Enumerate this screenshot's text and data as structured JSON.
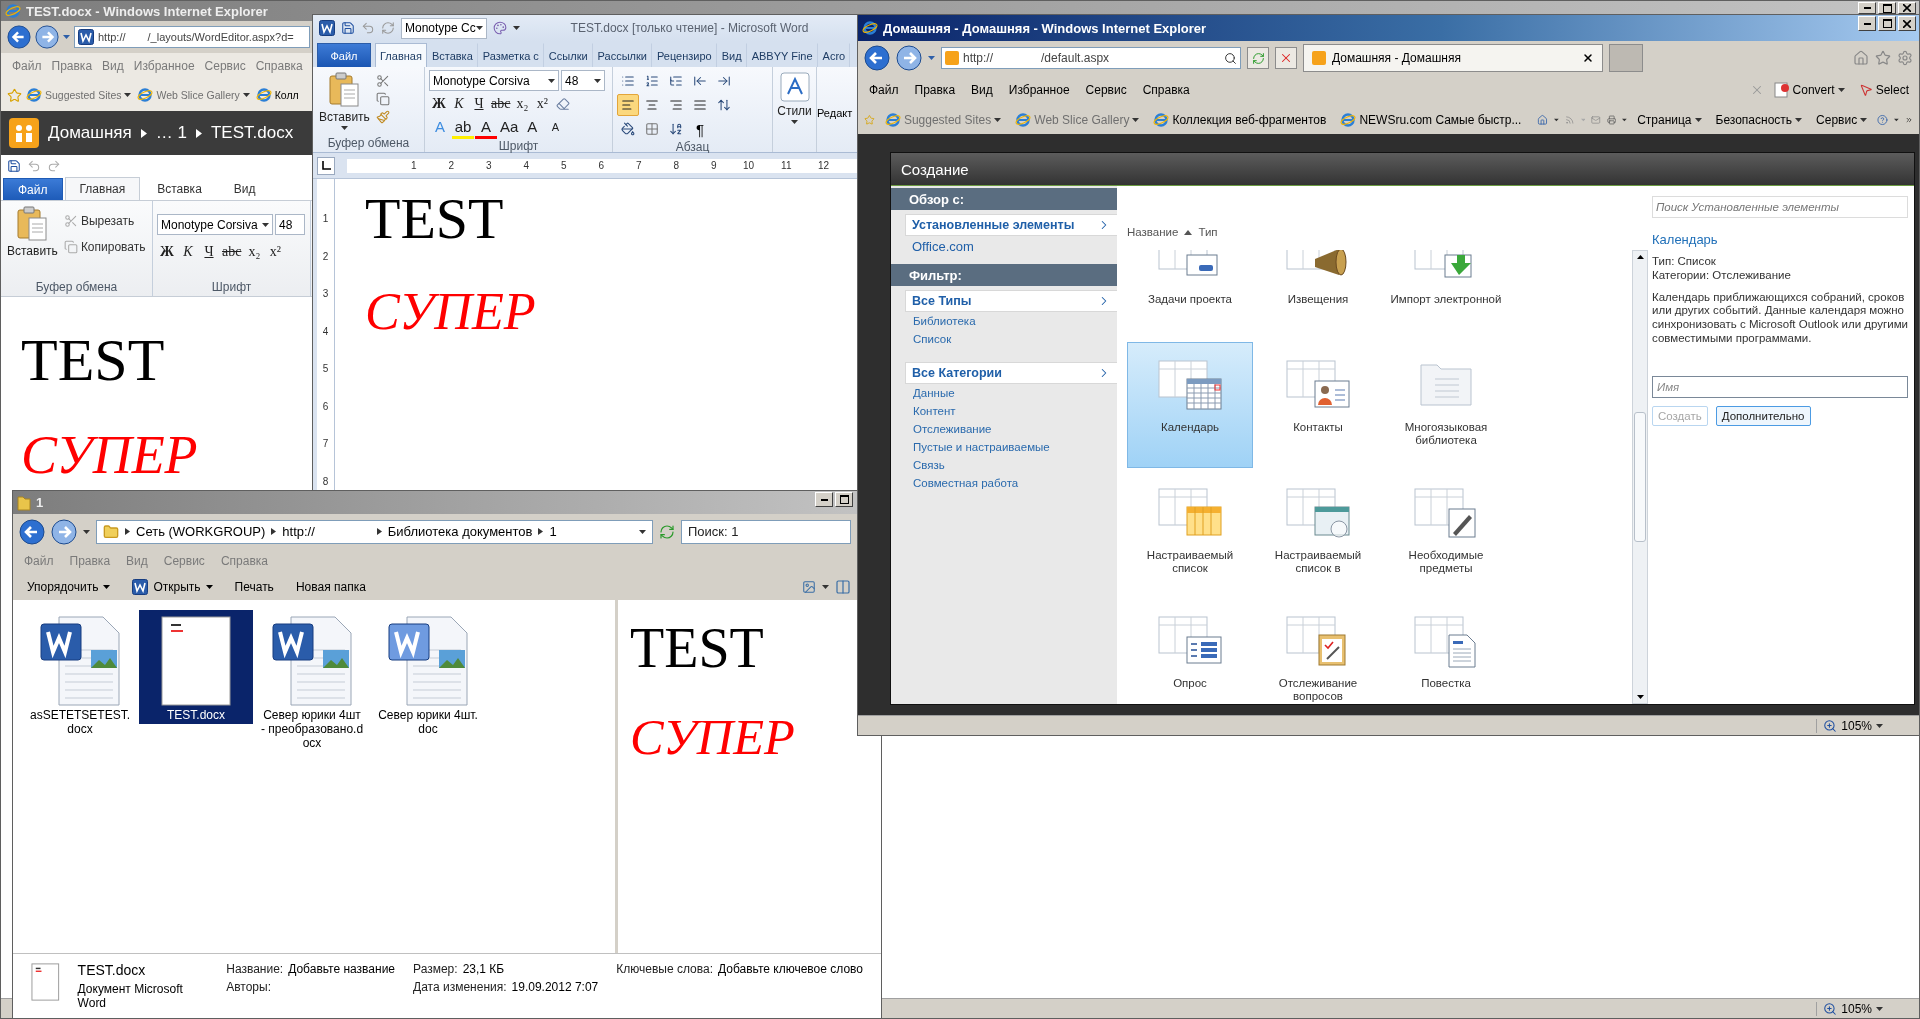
{
  "background_browser": {
    "title": "TEST.docx - Windows Internet Explorer",
    "address": "http://",
    "address_path": "/_layouts/WordEditor.aspx?d=",
    "menu": [
      "Файл",
      "Правка",
      "Вид",
      "Избранное",
      "Сервис",
      "Справка"
    ],
    "favorites": [
      {
        "label": "Suggested Sites",
        "dropdown": true
      },
      {
        "label": "Web Slice Gallery",
        "dropdown": true
      },
      {
        "label": "Колл",
        "dropdown": false
      }
    ],
    "breadcrumb": [
      "Домашняя",
      "… 1",
      "TEST.docx"
    ],
    "ribbon_tabs": [
      {
        "label": "Файл",
        "kind": "file",
        "selected": false
      },
      {
        "label": "Главная",
        "kind": "tab",
        "selected": true
      },
      {
        "label": "Вставка",
        "kind": "tab",
        "selected": false
      },
      {
        "label": "Вид",
        "kind": "tab",
        "selected": false
      }
    ],
    "paste": "Вставить",
    "cut": "Вырезать",
    "copy": "Копировать",
    "font": "Monotype Corsiva",
    "size": "48",
    "format_buttons": [
      {
        "text": "Ж",
        "kind": "bold"
      },
      {
        "text": "К",
        "kind": "italic"
      },
      {
        "text": "Ч",
        "kind": "underline"
      },
      {
        "text": "abc",
        "kind": "strike"
      },
      {
        "text": "x₂",
        "kind": "plain"
      },
      {
        "text": "x²",
        "kind": "plain"
      }
    ],
    "groups": [
      "Буфер обмена",
      "Шрифт"
    ],
    "document": [
      {
        "text": "TEST",
        "kind": "heading"
      },
      {
        "text": "СУПЕР",
        "kind": "script"
      }
    ],
    "zoom": "105%"
  },
  "word": {
    "quick_font": "Monotype Cc",
    "title": "TEST.docx [только чтение]  -  Microsoft Word",
    "tabs": [
      {
        "label": "Файл",
        "kind": "file",
        "selected": false
      },
      {
        "label": "Главная",
        "kind": "tab",
        "selected": true
      },
      {
        "label": "Вставка",
        "kind": "tab",
        "selected": false
      },
      {
        "label": "Разметка с",
        "kind": "tab",
        "selected": false
      },
      {
        "label": "Ссылки",
        "kind": "tab",
        "selected": false
      },
      {
        "label": "Рассылки",
        "kind": "tab",
        "selected": false
      },
      {
        "label": "Рецензиро",
        "kind": "tab",
        "selected": false
      },
      {
        "label": "Вид",
        "kind": "tab",
        "selected": false
      },
      {
        "label": "ABBYY Fine",
        "kind": "tab",
        "selected": false
      },
      {
        "label": "Acro",
        "kind": "tab",
        "selected": false
      }
    ],
    "paste": "Вставить",
    "font": "Monotype Corsiva",
    "size": "48",
    "format_buttons": [
      {
        "text": "Ж",
        "kind": "bold"
      },
      {
        "text": "К",
        "kind": "italic"
      },
      {
        "text": "Ч",
        "kind": "underline"
      },
      {
        "text": "abc",
        "kind": "strike"
      },
      {
        "text": "x₂",
        "kind": "plain"
      },
      {
        "text": "x²",
        "kind": "plain"
      }
    ],
    "effect_buttons": [
      {
        "text": "A",
        "kind": "effect"
      },
      {
        "text": "ab",
        "kind": "highlight"
      },
      {
        "text": "A",
        "kind": "color"
      },
      {
        "text": "Aa",
        "kind": "plain"
      },
      {
        "text": "A",
        "kind": "grow"
      },
      {
        "text": "A",
        "kind": "shrink"
      }
    ],
    "align_buttons": [
      {
        "kind": "left",
        "selected": true
      },
      {
        "kind": "center",
        "selected": false
      },
      {
        "kind": "right",
        "selected": false
      },
      {
        "kind": "justify",
        "selected": false
      }
    ],
    "pilcrow": "¶",
    "styles": "Стили",
    "editing": "Редакт",
    "groups": [
      "Буфер обмена",
      "Шрифт",
      "Абзац"
    ],
    "ruler": [
      "1",
      "2",
      "3",
      "4",
      "5",
      "6",
      "7",
      "8",
      "9",
      "10",
      "11",
      "12"
    ],
    "vertical_ruler": [
      "1",
      "2",
      "3",
      "4",
      "5",
      "6",
      "7",
      "8"
    ],
    "document": [
      {
        "text": "TEST",
        "kind": "heading"
      },
      {
        "text": "СУПЕР",
        "kind": "script"
      }
    ]
  },
  "explorer": {
    "title": "1",
    "path": [
      "Сеть (WORKGROUP)",
      "http://",
      "Библиотека документов",
      "1"
    ],
    "placeholder": "Поиск: 1",
    "menu": [
      "Файл",
      "Правка",
      "Вид",
      "Сервис",
      "Справка"
    ],
    "toolbar": [
      {
        "label": "Упорядочить",
        "kind": "menu"
      },
      {
        "label": "Открыть",
        "kind": "open"
      },
      {
        "label": "Печать",
        "kind": "plain"
      },
      {
        "label": "Новая папка",
        "kind": "plain"
      }
    ],
    "files": [
      {
        "name": "asSETETSETEST.docx",
        "kind": "word",
        "selected": false
      },
      {
        "name": "TEST.docx",
        "kind": "thumbnail",
        "selected": true
      },
      {
        "name": "Север юрики 4шт - преобразовано.docx",
        "kind": "word",
        "selected": false
      },
      {
        "name": "Север юрики 4шт.doc",
        "kind": "legacy",
        "selected": false
      }
    ],
    "preview": [
      {
        "text": "TEST",
        "kind": "heading"
      },
      {
        "text": "СУПЕР",
        "kind": "script"
      }
    ],
    "details": {
      "name": "TEST.docx",
      "type": "Документ Microsoft Word",
      "columns": [
        [
          {
            "label": "Название:",
            "value": "Добавьте название"
          },
          {
            "label": "Авторы:"
          }
        ],
        [
          {
            "label": "Размер:",
            "value": "23,1 КБ"
          },
          {
            "label": "Дата изменения:",
            "value": "19.09.2012 7:07"
          }
        ],
        [
          {
            "label": "Ключевые слова:",
            "value": "Добавьте ключевое слово"
          }
        ]
      ]
    }
  },
  "browser": {
    "title": "Домашняя - Домашняя - Windows Internet Explorer",
    "address": "http://",
    "address_path": "/default.aspx",
    "tab": "Домашняя - Домашняя",
    "menu": [
      "Файл",
      "Правка",
      "Вид",
      "Избранное",
      "Сервис",
      "Справка"
    ],
    "convert": "Convert",
    "select": "Select",
    "favorites": [
      {
        "label": "Suggested Sites",
        "dropdown": true
      },
      {
        "label": "Web Slice Gallery",
        "dropdown": true
      },
      {
        "label": "Коллекция веб-фрагментов",
        "dropdown": false
      },
      {
        "label": "NEWSru.com  Самые быстр...",
        "dropdown": false
      }
    ],
    "commands": [
      "Страница",
      "Безопасность",
      "Сервис"
    ],
    "zoom": "105%",
    "dialog": {
      "title": "Создание",
      "nav": [
        {
          "header": "Обзор с:",
          "items": [
            {
              "label": "Установленные элементы",
              "selected": true
            },
            {
              "label": "Office.com",
              "selected": false
            }
          ]
        },
        {
          "header": "Фильтр:",
          "items": [
            {
              "label": "Все Типы",
              "selected": true,
              "children": [
                "Библиотека",
                "Список"
              ]
            },
            {
              "label": "Все Категории",
              "selected": true,
              "children": [
                "Данные",
                "Контент",
                "Отслеживание",
                "Пустые и настраиваемые",
                "Связь",
                "Совместная работа"
              ]
            }
          ]
        }
      ],
      "sort": [
        "Название",
        "Тип"
      ],
      "tiles": [
        {
          "label": "Задачи проекта",
          "kind": "tasks",
          "selected": false
        },
        {
          "label": "Извещения",
          "kind": "announce",
          "selected": false
        },
        {
          "label": "Импорт электронной",
          "kind": "import",
          "selected": false
        },
        {
          "label": "Календарь",
          "kind": "calendar",
          "selected": true
        },
        {
          "label": "Контакты",
          "kind": "contacts",
          "selected": false
        },
        {
          "label": "Многоязыковая библиотека",
          "kind": "folder",
          "selected": false
        },
        {
          "label": "Настраиваемый список",
          "kind": "custom",
          "selected": false
        },
        {
          "label": "Настраиваемый список в",
          "kind": "datasheet",
          "selected": false
        },
        {
          "label": "Необходимые предметы",
          "kind": "notes",
          "selected": false
        },
        {
          "label": "Опрос",
          "kind": "survey",
          "selected": false
        },
        {
          "label": "Отслеживание вопросов",
          "kind": "issues",
          "selected": false
        },
        {
          "label": "Повестка",
          "kind": "agenda",
          "selected": false
        }
      ],
      "search_placeholder": "Поиск Установленные элементы",
      "selected_title": "Календарь",
      "meta": [
        "Тип: Список",
        "Категории: Отслеживание"
      ],
      "description": "Календарь приближающихся собраний, сроков или других событий.  Данные календаря можно синхронизовать с Microsoft Outlook или другими совместимыми программами.",
      "name_placeholder": "Имя",
      "buttons": [
        {
          "label": "Создать",
          "disabled": true
        },
        {
          "label": "Дополнительно",
          "disabled": false
        }
      ]
    }
  }
}
